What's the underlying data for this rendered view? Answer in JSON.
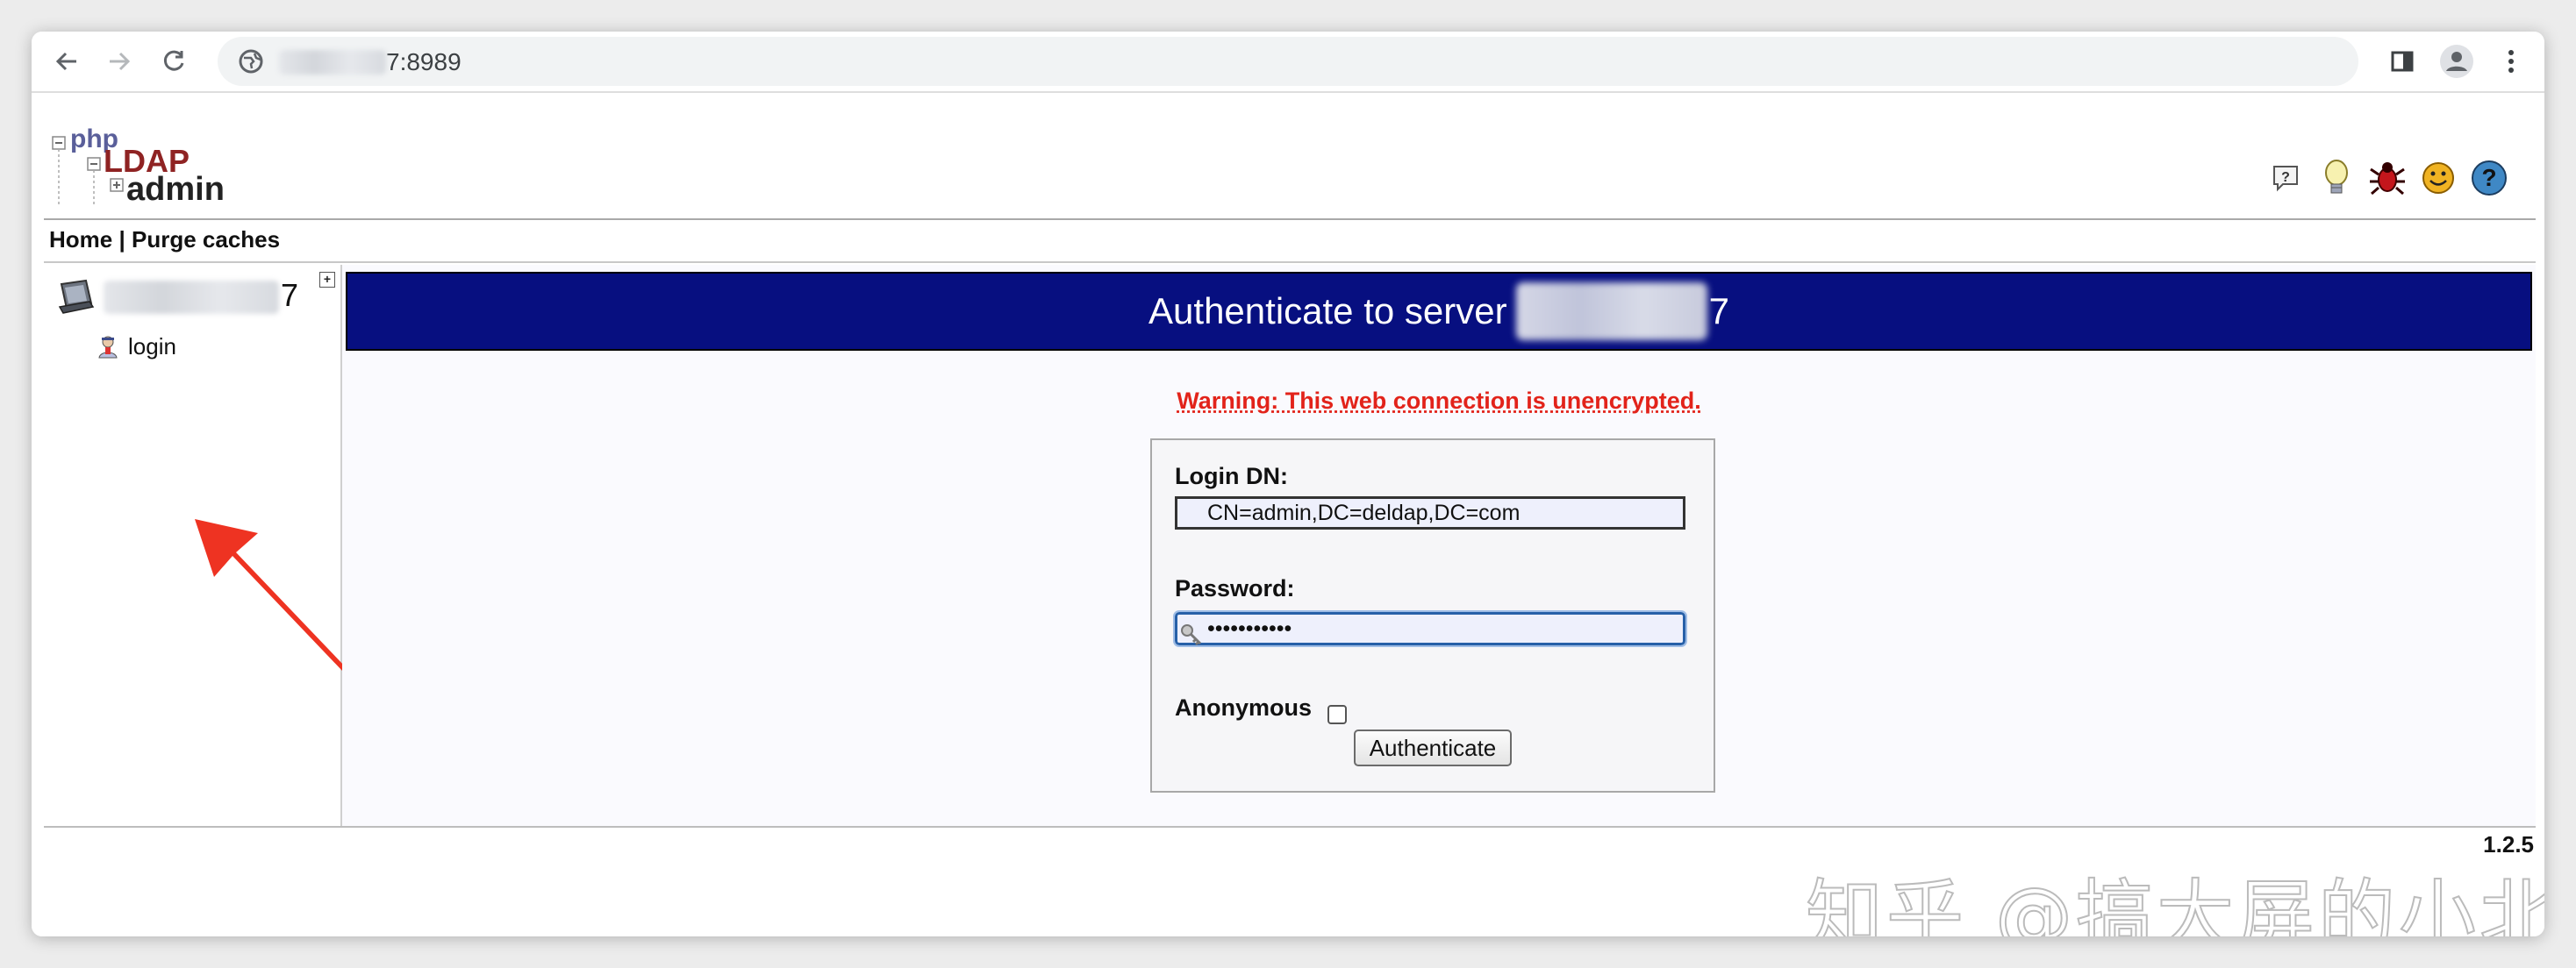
{
  "browser": {
    "url_visible": "7:8989",
    "icons": [
      "back-icon",
      "forward-icon",
      "reload-icon",
      "site-info-icon",
      "sidepanel-icon",
      "profile-icon",
      "menu-icon"
    ]
  },
  "header": {
    "logo_php": "php",
    "logo_ldap": "LDAP",
    "logo_admin": "admin",
    "icons": [
      "help-icon",
      "light-bulb-icon",
      "bug-icon",
      "smiley-icon",
      "help-circle-icon"
    ]
  },
  "nav": {
    "home": "Home",
    "separator": "|",
    "purge": "Purge caches"
  },
  "tree": {
    "server_suffix": "7",
    "expand": "+",
    "login_label": "login"
  },
  "main": {
    "title_prefix": "Authenticate to server",
    "title_suffix": "7",
    "warning": "Warning: This web connection is unencrypted.",
    "login_dn_label": "Login DN:",
    "login_dn_value": "CN=admin,DC=deldap,DC=com",
    "password_label": "Password:",
    "password_value": "•••••••••••",
    "anonymous_label": "Anonymous",
    "anonymous_checked": false,
    "authenticate_button": "Authenticate"
  },
  "footer": {
    "version": "1.2.5"
  },
  "watermark": "知乎 @搞大屏的小北",
  "colors": {
    "title_bar": "#070f80",
    "warning": "#e2231a",
    "field_bg": "#eef0fc",
    "annotation_arrow": "#ee3322"
  }
}
